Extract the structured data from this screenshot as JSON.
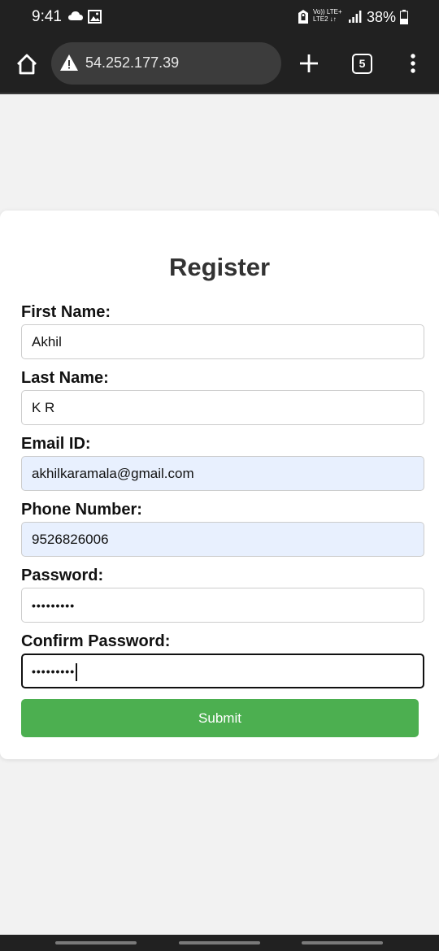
{
  "status_bar": {
    "time": "9:41",
    "network_top": "Vo)) LTE+",
    "network_bottom": "LTE2 ↓↑",
    "battery": "38%"
  },
  "browser": {
    "url": "54.252.177.39",
    "tab_count": "5"
  },
  "form": {
    "title": "Register",
    "fields": [
      {
        "label": "First Name:",
        "value": "Akhil"
      },
      {
        "label": "Last Name:",
        "value": "K R"
      },
      {
        "label": "Email ID:",
        "value": "akhilkaramala@gmail.com"
      },
      {
        "label": "Phone Number:",
        "value": "9526826006"
      },
      {
        "label": "Password:",
        "value": "•••••••••"
      },
      {
        "label": "Confirm Password:",
        "value": "•••••••••"
      }
    ],
    "submit_label": "Submit"
  },
  "colors": {
    "submit": "#4caf50",
    "autofill": "#e8f0fe",
    "chrome_bar": "#212121"
  }
}
